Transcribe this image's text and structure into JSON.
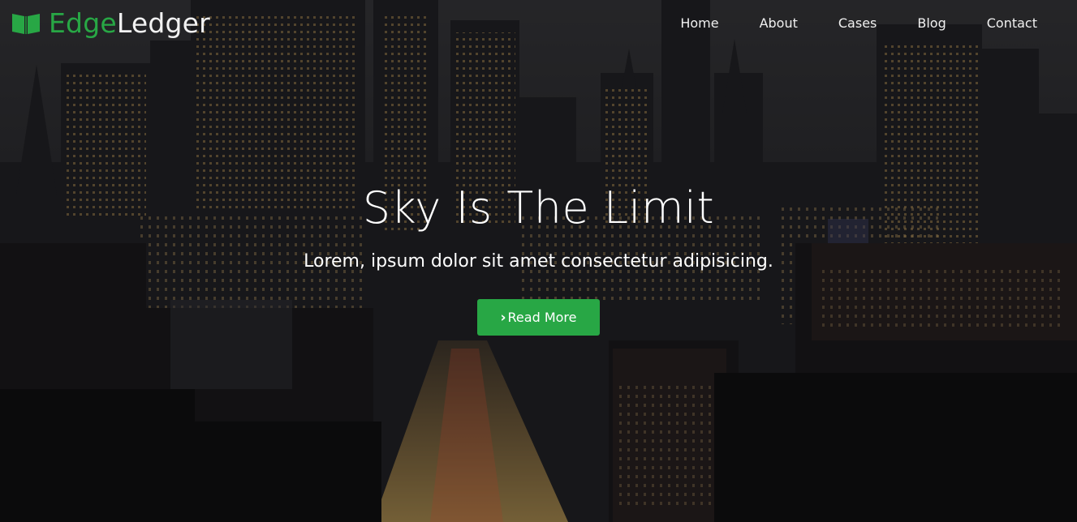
{
  "brand": {
    "name_part1": "Edge",
    "name_part2": "Ledger",
    "icon": "open-book-icon",
    "accent_color": "#28a745"
  },
  "nav": {
    "items": [
      {
        "label": "Home"
      },
      {
        "label": "About"
      },
      {
        "label": "Cases"
      },
      {
        "label": "Blog"
      },
      {
        "label": "Contact"
      }
    ]
  },
  "hero": {
    "title": "Sky Is The Limit",
    "subtitle": "Lorem, ipsum dolor sit amet consectetur adipisicing.",
    "button_label": "Read More",
    "button_icon": "chevron-right-icon",
    "button_color": "#28a745",
    "background": "night-city-skyline-photo"
  }
}
